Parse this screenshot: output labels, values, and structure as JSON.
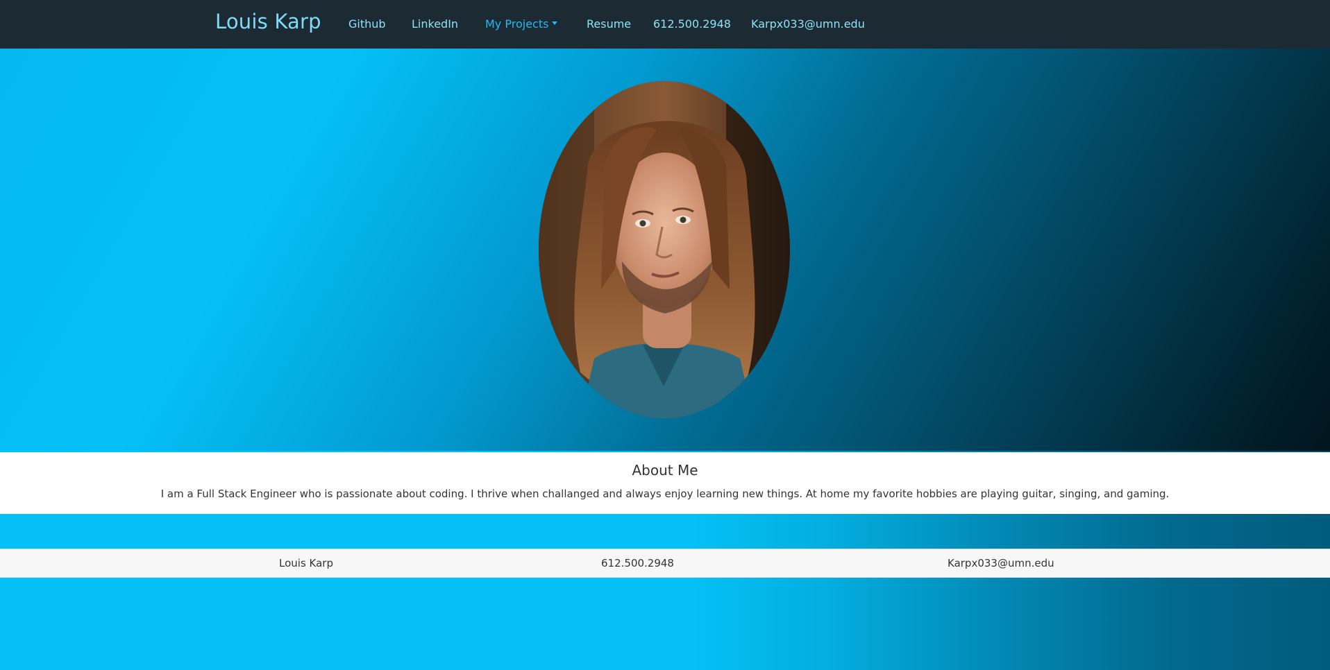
{
  "navbar": {
    "brand": "Louis Karp",
    "links": [
      {
        "label": "Github"
      },
      {
        "label": "LinkedIn"
      },
      {
        "label": "My Projects"
      },
      {
        "label": "Resume"
      },
      {
        "label": "612.500.2948"
      },
      {
        "label": "Karpx033@umn.edu"
      }
    ]
  },
  "about": {
    "title": "About Me",
    "body": "I am a Full Stack Engineer who is passionate about coding. I thrive when challanged and always enjoy learning new things. At home my favorite hobbies are playing guitar, singing, and gaming."
  },
  "footer": {
    "name": "Louis Karp",
    "phone": "612.500.2948",
    "email": "Karpx033@umn.edu"
  },
  "colors": {
    "navbar_bg": "#1b2a33",
    "brand": "#7fdcf5",
    "link": "#8fe2f7",
    "active_link": "#29b9ee",
    "accent_cyan": "#04c0f6"
  }
}
